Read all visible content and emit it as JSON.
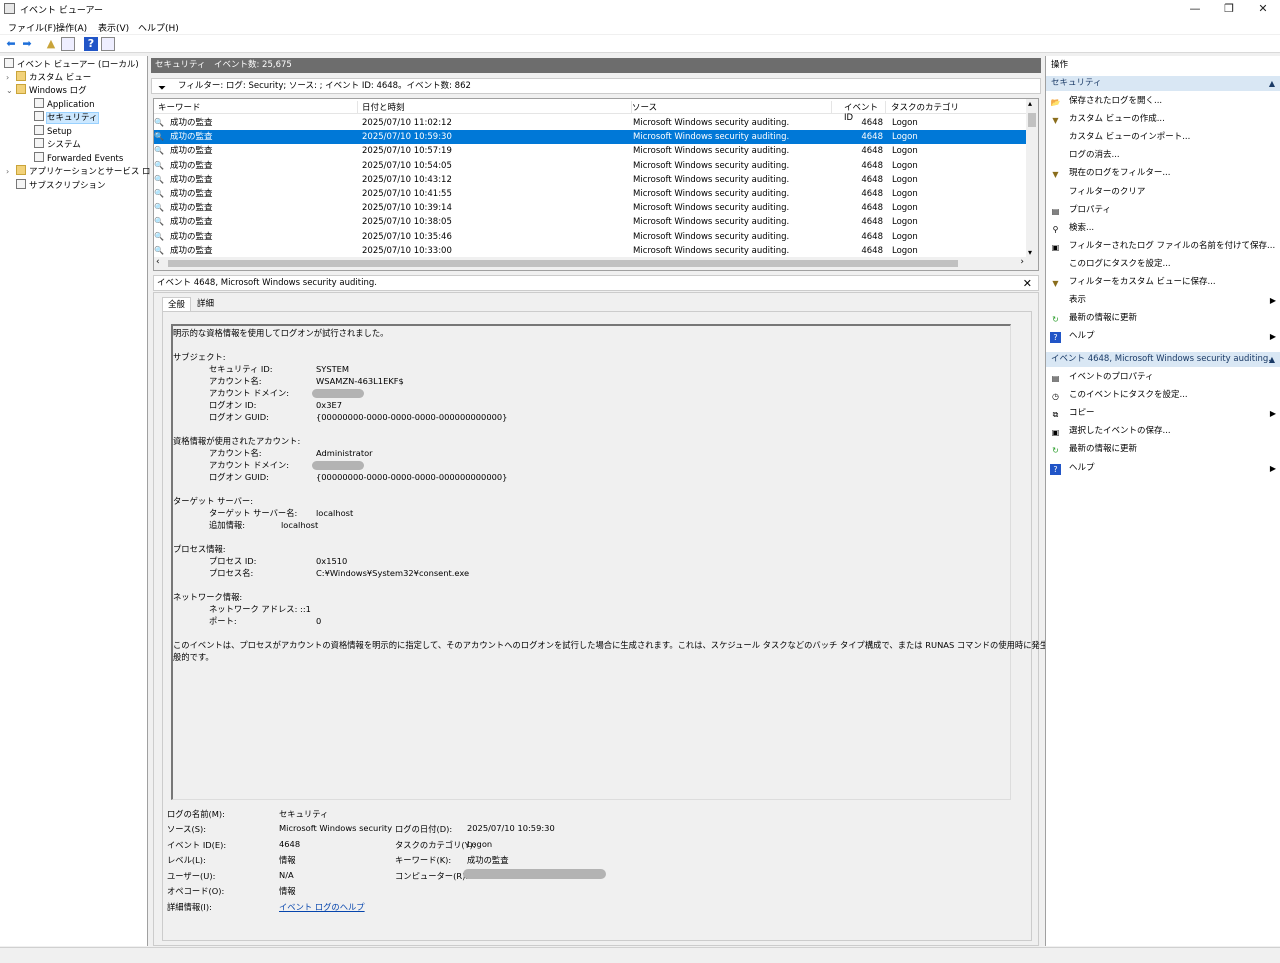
{
  "window": {
    "title": "イベント ビューアー",
    "min": "—",
    "max": "❐",
    "close": "✕"
  },
  "menu": [
    "ファイル(F)",
    "操作(A)",
    "表示(V)",
    "ヘルプ(H)"
  ],
  "tree": {
    "root": "イベント ビューアー (ローカル)",
    "custom": "カスタム ビュー",
    "winlogs": "Windows ログ",
    "app": "Application",
    "security": "セキュリティ",
    "setup": "Setup",
    "system": "システム",
    "forwarded": "Forwarded Events",
    "appsvc": "アプリケーションとサービス ログ",
    "subs": "サブスクリプション"
  },
  "middle": {
    "header": "セキュリティ　イベント数: 25,675",
    "filter": "フィルター: ログ: Security; ソース: ; イベント ID: 4648。イベント数: 862",
    "columns": {
      "keyword": "キーワード",
      "datetime": "日付と時刻",
      "source": "ソース",
      "eventid": "イベント ID",
      "category": "タスクのカテゴリ"
    },
    "rows": [
      {
        "keyword": "成功の監査",
        "datetime": "2025/07/10 11:02:12",
        "source": "Microsoft Windows security auditing.",
        "eventid": "4648",
        "category": "Logon"
      },
      {
        "keyword": "成功の監査",
        "datetime": "2025/07/10 10:59:30",
        "source": "Microsoft Windows security auditing.",
        "eventid": "4648",
        "category": "Logon"
      },
      {
        "keyword": "成功の監査",
        "datetime": "2025/07/10 10:57:19",
        "source": "Microsoft Windows security auditing.",
        "eventid": "4648",
        "category": "Logon"
      },
      {
        "keyword": "成功の監査",
        "datetime": "2025/07/10 10:54:05",
        "source": "Microsoft Windows security auditing.",
        "eventid": "4648",
        "category": "Logon"
      },
      {
        "keyword": "成功の監査",
        "datetime": "2025/07/10 10:43:12",
        "source": "Microsoft Windows security auditing.",
        "eventid": "4648",
        "category": "Logon"
      },
      {
        "keyword": "成功の監査",
        "datetime": "2025/07/10 10:41:55",
        "source": "Microsoft Windows security auditing.",
        "eventid": "4648",
        "category": "Logon"
      },
      {
        "keyword": "成功の監査",
        "datetime": "2025/07/10 10:39:14",
        "source": "Microsoft Windows security auditing.",
        "eventid": "4648",
        "category": "Logon"
      },
      {
        "keyword": "成功の監査",
        "datetime": "2025/07/10 10:38:05",
        "source": "Microsoft Windows security auditing.",
        "eventid": "4648",
        "category": "Logon"
      },
      {
        "keyword": "成功の監査",
        "datetime": "2025/07/10 10:35:46",
        "source": "Microsoft Windows security auditing.",
        "eventid": "4648",
        "category": "Logon"
      },
      {
        "keyword": "成功の監査",
        "datetime": "2025/07/10 10:33:00",
        "source": "Microsoft Windows security auditing.",
        "eventid": "4648",
        "category": "Logon"
      }
    ],
    "detail_title": "イベント 4648, Microsoft Windows security auditing.",
    "tabs": [
      "全般",
      "詳細"
    ],
    "desc": {
      "intro": "明示的な資格情報を使用してログオンが試行されました。",
      "subject": "サブジェクト:",
      "sec_id_l": "セキュリティ ID:",
      "sec_id_v": "SYSTEM",
      "acct_l": "アカウント名:",
      "acct_v": "WSAMZN-463L1EKF$",
      "dom_l": "アカウント ドメイン:",
      "logon_id_l": "ログオン ID:",
      "logon_id_v": "0x3E7",
      "guid_l": "ログオン GUID:",
      "guid_v": "{00000000-0000-0000-0000-000000000000}",
      "cred": "資格情報が使用されたアカウント:",
      "acct2_v": "Administrator",
      "target": "ターゲット サーバー:",
      "tsrv_l": "ターゲット サーバー名:",
      "tsrv_v": "localhost",
      "extra_l": "追加情報:",
      "extra_v": "localhost",
      "proc": "プロセス情報:",
      "pid_l": "プロセス ID:",
      "pid_v": "0x1510",
      "pname_l": "プロセス名:",
      "pname_v": "C:¥Windows¥System32¥consent.exe",
      "net": "ネットワーク情報:",
      "addr_l": "ネットワーク アドレス: ::1",
      "port_l": "ポート:",
      "port_v": "0",
      "footer1": "このイベントは、プロセスがアカウントの資格情報を明示的に指定して、そのアカウントへのログオンを試行した場合に生成されます。これは、スケジュール タスクなどのバッチ タイプ構成で、または RUNAS コマンドの使用時に発生するのが最も一",
      "footer2": "般的です。"
    },
    "meta": {
      "logname_l": "ログの名前(M):",
      "logname_v": "セキュリティ",
      "source_l": "ソース(S):",
      "source_v": "Microsoft Windows security a",
      "date_l": "ログの日付(D):",
      "date_v": "2025/07/10 10:59:30",
      "eid_l": "イベント ID(E):",
      "eid_v": "4648",
      "cat_l": "タスクのカテゴリ(Y):",
      "cat_v": "Logon",
      "level_l": "レベル(L):",
      "level_v": "情報",
      "kw_l": "キーワード(K):",
      "kw_v": "成功の監査",
      "user_l": "ユーザー(U):",
      "user_v": "N/A",
      "comp_l": "コンピューター(R):",
      "op_l": "オペコード(O):",
      "op_v": "情報",
      "more_l": "詳細情報(I):",
      "more_v": "イベント ログのヘルプ"
    }
  },
  "actions": {
    "header": "操作",
    "sec1": "セキュリティ",
    "items1": [
      "保存されたログを開く...",
      "カスタム ビューの作成...",
      "カスタム ビューのインポート...",
      "ログの消去...",
      "現在のログをフィルター...",
      "フィルターのクリア",
      "プロパティ",
      "検索...",
      "フィルターされたログ ファイルの名前を付けて保存...",
      "このログにタスクを設定...",
      "フィルターをカスタム ビューに保存...",
      "表示",
      "最新の情報に更新",
      "ヘルプ"
    ],
    "sec2": "イベント 4648, Microsoft Windows security auditing.",
    "items2": [
      "イベントのプロパティ",
      "このイベントにタスクを設定...",
      "コピー",
      "選択したイベントの保存...",
      "最新の情報に更新",
      "ヘルプ"
    ]
  }
}
